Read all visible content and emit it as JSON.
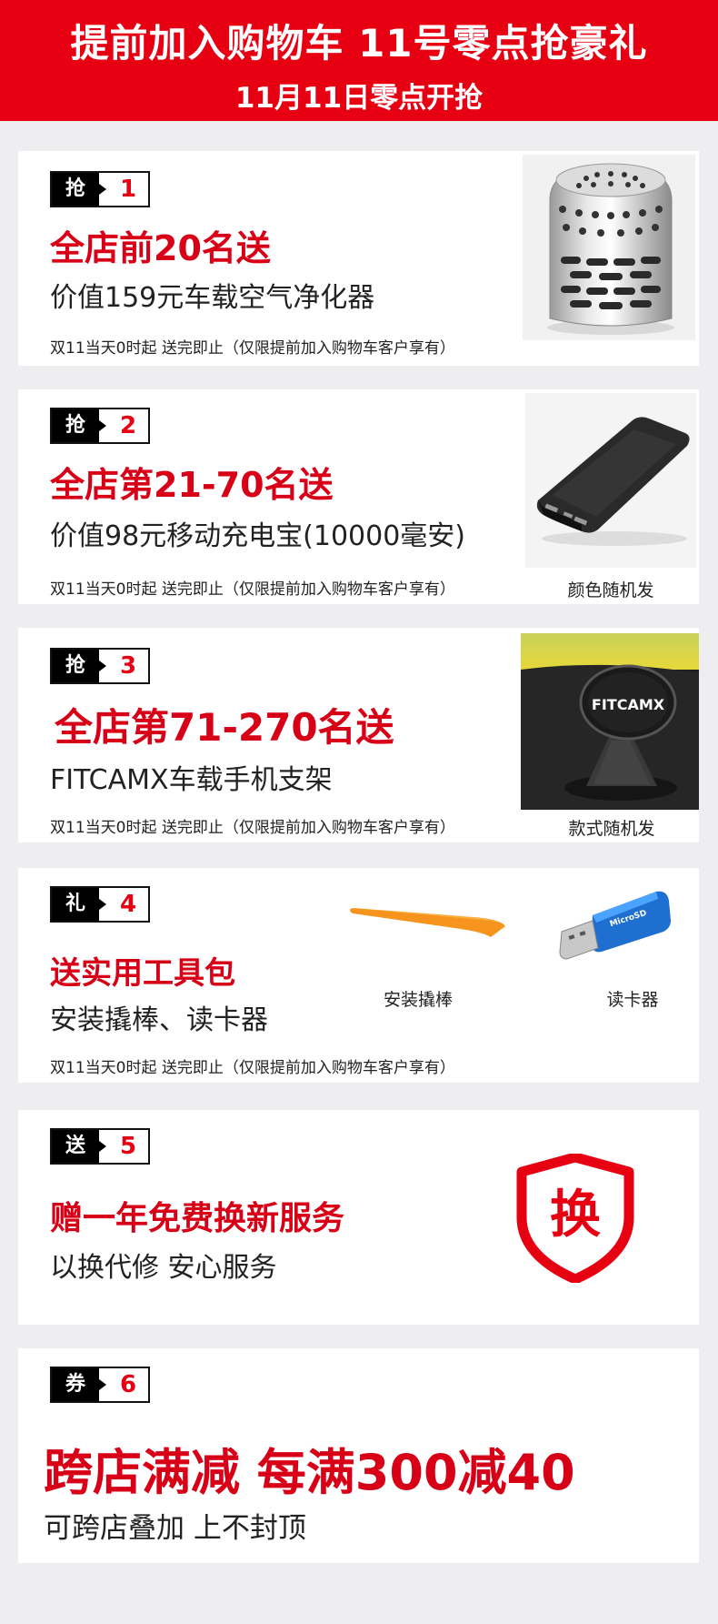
{
  "banner": {
    "title": "提前加入购物车   11号零点抢豪礼",
    "subtitle": "11月11日零点开抢"
  },
  "colors": {
    "accent": "#e60012",
    "tag_bg": "#000000",
    "page_bg": "#eeeef0"
  },
  "cards": [
    {
      "tag_label": "抢",
      "tag_number": "1",
      "headline": "全店前20名送",
      "subhead": "价值159元车载空气净化器",
      "note": "双11当天0时起 送完即止（仅限提前加入购物车客户享有）",
      "image_icon": "air-purifier-icon"
    },
    {
      "tag_label": "抢",
      "tag_number": "2",
      "headline": "全店第21-70名送",
      "subhead": "价值98元移动充电宝(10000毫安)",
      "note": "双11当天0时起 送完即止（仅限提前加入购物车客户享有）",
      "image_caption": "颜色随机发",
      "image_icon": "power-bank-icon"
    },
    {
      "tag_label": "抢",
      "tag_number": "3",
      "headline": "全店第71-270名送",
      "subhead": "FITCAMX车载手机支架",
      "note": "双11当天0时起 送完即止（仅限提前加入购物车客户享有）",
      "image_caption": "款式随机发",
      "image_brand": "FITCAMX",
      "image_icon": "phone-mount-icon"
    },
    {
      "tag_label": "礼",
      "tag_number": "4",
      "headline": "送实用工具包",
      "subhead": "安装撬棒、读卡器",
      "note": "双11当天0时起 送完即止（仅限提前加入购物车客户享有）",
      "tool1_caption": "安装撬棒",
      "tool2_caption": "读卡器",
      "tool1_icon": "pry-bar-icon",
      "tool2_icon": "card-reader-icon"
    },
    {
      "tag_label": "送",
      "tag_number": "5",
      "headline": "赠一年免费换新服务",
      "subhead": "以换代修 安心服务",
      "badge_text": "换",
      "badge_icon": "shield-icon"
    },
    {
      "tag_label": "券",
      "tag_number": "6",
      "headline": "跨店满减 每满300减40",
      "subhead": "可跨店叠加 上不封顶"
    }
  ]
}
